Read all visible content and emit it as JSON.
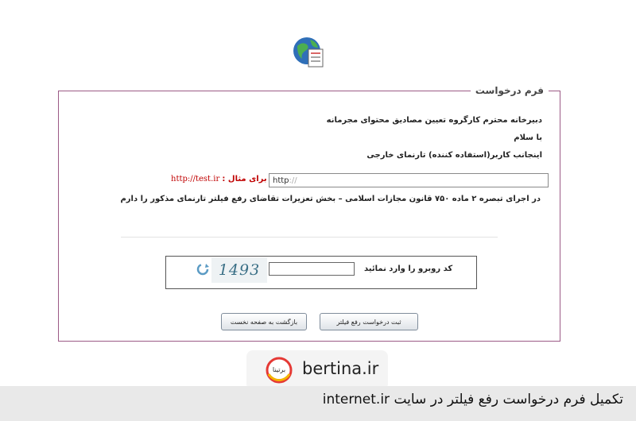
{
  "form": {
    "legend": "فرم درخواست",
    "recipient": "دبیرخانه محترم کارگروه تعیین مصادیق محتوای مجرمانه",
    "greeting": "با سلام",
    "intro": "اینجانب کاربر(استفاده کننده) تارنمای خارجی",
    "url_value_prefix": "http",
    "url_value_suffix": "://",
    "example_label": "برای مثال :",
    "example_url": "http://test.ir",
    "request_text": "در اجرای تبصره ۲ ماده ۷۵۰ قانون مجازات اسلامی – بخش تعزیرات تقاضای رفع فیلتر تارنمای مذکور را دارم"
  },
  "captcha": {
    "code": "1493",
    "label": "کد روبرو را وارد نمائید"
  },
  "buttons": {
    "submit": "ثبت درخواست رفع فیلتر",
    "back": "بازگشت به صفحه نخست"
  },
  "brand": {
    "name": "bertina.ir",
    "logo_text": "برتینا"
  },
  "caption": "تکمیل فرم درخواست رفع فیلتر در سایت internet.ir",
  "colors": {
    "border": "#9b5a86",
    "example": "#c00000",
    "logo_ring": "#e53935",
    "logo_ring2": "#f4b400"
  },
  "icons": {
    "header": "globe-document-icon",
    "refresh": "refresh-icon"
  }
}
